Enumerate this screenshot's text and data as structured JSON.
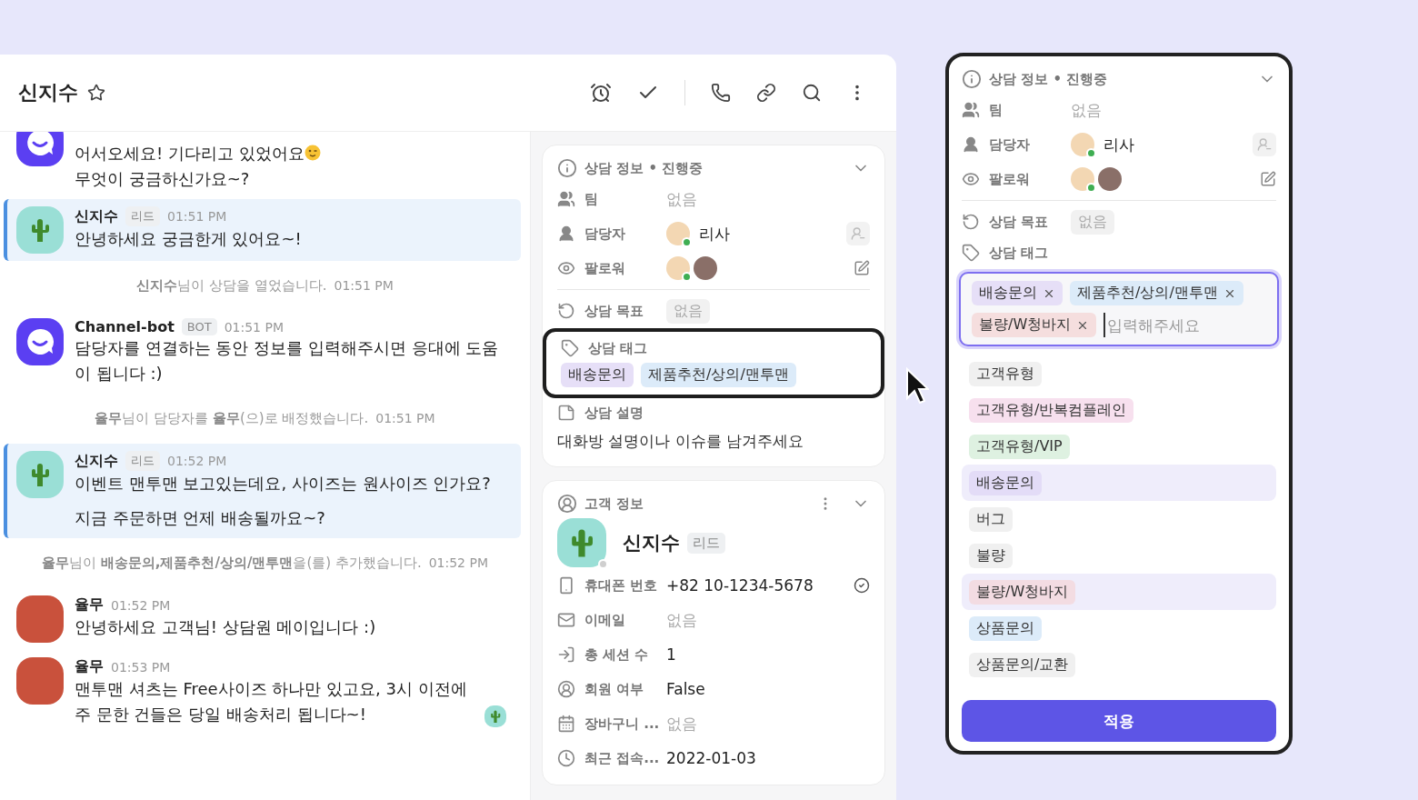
{
  "chat": {
    "title": "신지수",
    "starred": false,
    "messages": [
      {
        "kind": "message",
        "avatar": {
          "kind": "bot"
        },
        "highlighted": false,
        "emoji": {
          "kind": "wink"
        },
        "lines": [
          "어서오세요! 기다리고 있었어요",
          "무엇이 궁금하신가요~?"
        ]
      },
      {
        "kind": "message",
        "avatar": {
          "kind": "cactus"
        },
        "highlighted": true,
        "sender": "신지수",
        "badge": "리드",
        "time": "01:51 PM",
        "lines": [
          "안녕하세요 궁금한게 있어요~!"
        ]
      },
      {
        "kind": "system",
        "text": "**신지수**님이 상담을 열었습니다.",
        "time": "01:51 PM"
      },
      {
        "kind": "message",
        "avatar": {
          "kind": "bot"
        },
        "highlighted": false,
        "sender": "Channel-bot",
        "badge": "BOT",
        "time": "01:51 PM",
        "lines": [
          "담당자를 연결하는 동안 정보를 입력해주시면 응대에 도움 이 됩니다 :)"
        ]
      },
      {
        "kind": "system",
        "text": "**율무**님이 담당자를 **율무**(으)로 배정했습니다.",
        "time": "01:51 PM"
      },
      {
        "kind": "message",
        "avatar": {
          "kind": "cactus"
        },
        "highlighted": true,
        "sender": "신지수",
        "badge": "리드",
        "time": "01:52 PM",
        "lines": [
          "이벤트 맨투맨 보고있는데요, 사이즈는 원사이즈 인가요?",
          "지금 주문하면 언제 배송될까요~?"
        ]
      },
      {
        "kind": "system",
        "text": "**율무**님이 **배송문의,제품추천/상의/맨투맨**을(를) 추가했습니다.",
        "time": "01:52 PM"
      },
      {
        "kind": "message",
        "avatar": {
          "kind": "photo"
        },
        "highlighted": false,
        "sender": "율무",
        "time": "01:52 PM",
        "lines": [
          "안녕하세요 고객님! 상담원 메이입니다 :)"
        ]
      },
      {
        "kind": "message",
        "avatar": {
          "kind": "photo"
        },
        "highlighted": false,
        "sender": "율무",
        "time": "01:53 PM",
        "read": true,
        "lines": [
          "맨투맨 셔츠는 Free사이즈 하나만 있고요, 3시 이전에 주 문한 건들은 당일 배송처리 됩니다~!"
        ]
      }
    ]
  },
  "consult": {
    "title": "상담 정보 • 진행중",
    "expanded": true,
    "team": {
      "label": "팀",
      "value": "없음",
      "empty": true
    },
    "assignee": {
      "label": "담당자",
      "name": "리사",
      "online": true
    },
    "followers": {
      "label": "팔로워",
      "avatars": [
        {
          "kind": "cartoon",
          "online": true
        },
        {
          "kind": "photo",
          "online": false
        }
      ]
    },
    "goal": {
      "label": "상담 목표",
      "value": "없음"
    },
    "tags": {
      "label": "상담 태그",
      "items": [
        {
          "label": "배송문의",
          "color": "#e6dff7"
        },
        {
          "label": "제품추천/상의/맨투맨",
          "color": "#dcebf9"
        }
      ]
    },
    "description": {
      "label": "상담 설명",
      "placeholder": "대화방 설명이나 이슈를 남겨주세요"
    }
  },
  "customer": {
    "title": "고객 정보",
    "name": "신지수",
    "badge": "리드",
    "online": false,
    "fields": [
      {
        "kind": "phone",
        "label": "휴대폰 번호",
        "value": "+82 10-1234-5678",
        "empty": false,
        "verified": true
      },
      {
        "kind": "email",
        "label": "이메일",
        "value": "없음",
        "empty": true
      },
      {
        "kind": "sessions",
        "label": "총 세션 수",
        "value": "1",
        "empty": false
      },
      {
        "kind": "member",
        "label": "회원 여부",
        "value": "False",
        "empty": false
      },
      {
        "kind": "cart",
        "label": "장바구니 ...",
        "value": "없음",
        "empty": true
      },
      {
        "kind": "recent",
        "label": "최근 접속...",
        "value": "2022-01-03",
        "empty": false
      }
    ]
  },
  "tag_panel": {
    "title": "상담 정보 • 진행중",
    "expanded": true,
    "team": {
      "label": "팀",
      "value": "없음",
      "empty": true
    },
    "assignee": {
      "label": "담당자",
      "name": "리사",
      "online": true
    },
    "followers": {
      "label": "팔로워",
      "avatars": [
        {
          "kind": "cartoon",
          "online": true
        },
        {
          "kind": "photo",
          "online": false
        }
      ]
    },
    "goal": {
      "label": "상담 목표",
      "value": "없음"
    },
    "tags": {
      "label": "상담 태그"
    },
    "selected_tags": [
      {
        "label": "배송문의",
        "color": "#e6dff7"
      },
      {
        "label": "제품추천/상의/맨투맨",
        "color": "#dcebf9"
      },
      {
        "label": "불량/W청바지",
        "color": "#f5dede"
      }
    ],
    "placeholder": "입력해주세요",
    "options": [
      {
        "label": "고객유형",
        "color": "#f0f0f0",
        "selected": false
      },
      {
        "label": "고객유형/반복컴플레인",
        "color": "#f7e0ee",
        "selected": false
      },
      {
        "label": "고객유형/VIP",
        "color": "#def1e1",
        "selected": false
      },
      {
        "label": "배송문의",
        "color": "#e3dcf7",
        "selected": true
      },
      {
        "label": "버그",
        "color": "#f0f0f0",
        "selected": false
      },
      {
        "label": "불량",
        "color": "#f0f0f0",
        "selected": false
      },
      {
        "label": "불량/W청바지",
        "color": "#f3dce2",
        "selected": true
      },
      {
        "label": "상품문의",
        "color": "#dcebf9",
        "selected": false
      },
      {
        "label": "상품문의/교환",
        "color": "#f0f0f0",
        "selected": false
      }
    ],
    "apply": "적용"
  }
}
